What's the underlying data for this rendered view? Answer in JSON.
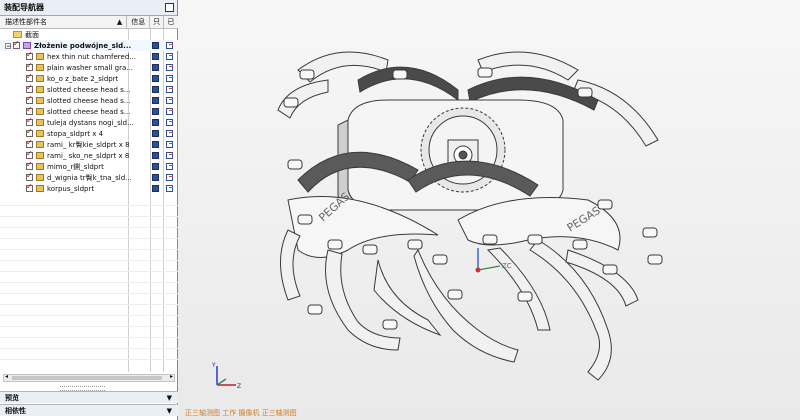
{
  "navigator": {
    "title": "装配导航器",
    "columns": {
      "name": "描述性部件名",
      "info": "信息",
      "readonly": "只",
      "modified": "已"
    },
    "section_views": "截面",
    "root": "Złożenie podwójne_sld...",
    "items": [
      "hex thin nut chamfered...",
      "plain washer small gra...",
      "ko_o z_bate 2_sldprt",
      "slotted cheese head s...",
      "slotted cheese head s...",
      "slotted cheese head s...",
      "tuleja dystans nogi_sld...",
      "stopa_sldprt x 4",
      "rami_ kr臀kie_sldprt x 8",
      "rami_ sko_ne_sldprt x 8",
      "mimo_r鍘_sldprt",
      "d_wignia tr臀k_tna_sld...",
      "korpus_sldprt"
    ],
    "panels": {
      "preview": "预览",
      "dependencies": "相依性"
    }
  },
  "status_text": "正三轴测图 工作 摄像机 正三轴测图",
  "model_labels": {
    "brand_left": "PEGAS",
    "brand_right": "PEGAS"
  },
  "triad": {
    "x": "X",
    "y": "Y",
    "z": "Z",
    "zc": "ZC"
  },
  "colors": {
    "model_fill": "#f1f1f1",
    "model_edge": "#3a3a3a",
    "background": "#efefef",
    "status": "#d07a22"
  }
}
